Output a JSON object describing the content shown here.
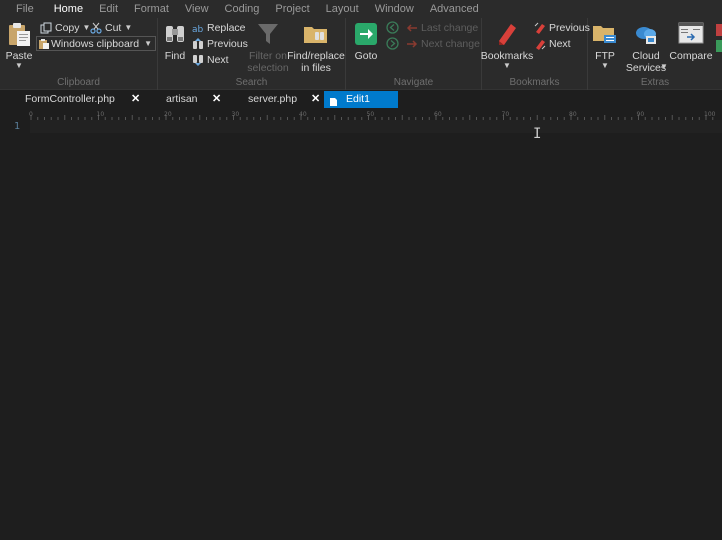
{
  "menu": [
    "File",
    "Home",
    "Edit",
    "Format",
    "View",
    "Coding",
    "Project",
    "Layout",
    "Window",
    "Advanced"
  ],
  "active_menu": "Home",
  "ribbon": {
    "clipboard": {
      "label": "Clipboard",
      "paste": "Paste",
      "copy": "Copy",
      "cut": "Cut",
      "clipboard_select": "Windows clipboard"
    },
    "search": {
      "label": "Search",
      "find": "Find",
      "replace": "Replace",
      "previous": "Previous",
      "next": "Next",
      "filter_line1": "Filter on",
      "filter_line2": "selection",
      "findreplace_line1": "Find/replace",
      "findreplace_line2": "in files"
    },
    "navigate": {
      "label": "Navigate",
      "goto": "Goto",
      "last_change": "Last change",
      "next_change": "Next change"
    },
    "bookmarks": {
      "label": "Bookmarks",
      "bookmarks": "Bookmarks",
      "previous": "Previous",
      "next": "Next"
    },
    "extras": {
      "label": "Extras",
      "ftp": "FTP",
      "cloud_line1": "Cloud",
      "cloud_line2": "Services",
      "compare": "Compare"
    }
  },
  "tabs": [
    {
      "label": "FormController.php",
      "active": false
    },
    {
      "label": "artisan",
      "active": false
    },
    {
      "label": "server.php",
      "active": false
    },
    {
      "label": "Edit1",
      "active": true
    }
  ],
  "ruler_labels": [
    "0",
    "10",
    "20",
    "30",
    "40",
    "50",
    "60",
    "70",
    "80",
    "90",
    "100"
  ],
  "editor": {
    "line_number": "1"
  },
  "colors": {
    "accent": "#007acc",
    "background": "#1e1e1e",
    "ribbon": "#2b2b2b"
  }
}
